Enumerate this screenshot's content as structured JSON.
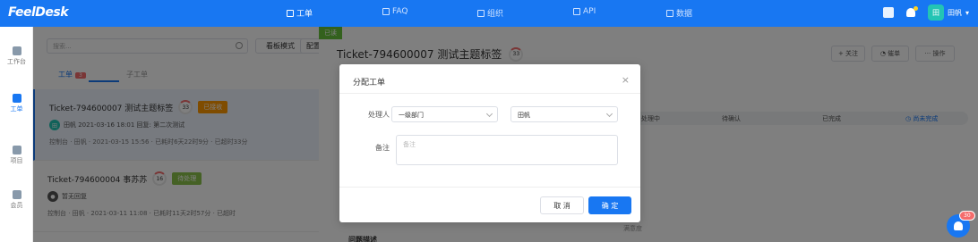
{
  "app": {
    "logo": "FeelDesk"
  },
  "topnav": {
    "items": [
      {
        "label": "工单",
        "icon": "ticket-icon",
        "active": true
      },
      {
        "label": "FAQ",
        "icon": "faq-icon",
        "active": false
      },
      {
        "label": "组织",
        "icon": "org-icon",
        "active": false
      },
      {
        "label": "API",
        "icon": "api-icon",
        "active": false
      },
      {
        "label": "数据",
        "icon": "chart-icon",
        "active": false
      }
    ],
    "user": {
      "avatar": "田",
      "name": "田帆"
    }
  },
  "sidebar": {
    "items": [
      {
        "label": "工作台",
        "icon": "dashboard-icon",
        "active": false
      },
      {
        "label": "工单",
        "icon": "ticket-icon",
        "active": true
      },
      {
        "label": "项目",
        "icon": "folder-icon",
        "active": false
      },
      {
        "label": "会员",
        "icon": "member-icon",
        "active": false
      }
    ]
  },
  "list": {
    "search_placeholder": "搜索...",
    "kanban_button": "看板模式",
    "config_button": "配置",
    "tabs": [
      {
        "label": "工单",
        "count": "3",
        "active": true
      },
      {
        "label": "子工单",
        "active": false
      }
    ],
    "tickets": [
      {
        "id_title": "Ticket-794600007  测试主题标签",
        "progress": "33",
        "status": "已接收",
        "status_color": "#ff9800",
        "avatar": "田",
        "avatar_color": "#23c4b4",
        "reply": "田帆  2021-03-16 18:01 回复: 第二次测试",
        "info": "控制台  ·  田帆  ·  2021-03-15 15:56  ·  已耗时6天22时9分  ·  已超时33分"
      },
      {
        "id_title": "Ticket-794600004  事苏苏",
        "progress": "16",
        "status": "待处理",
        "status_color": "#8bc34a",
        "avatar": "●",
        "avatar_color": "#555555",
        "reply": "暂无回复",
        "info": "控制台  ·  田帆  ·  2021-03-11 11:08  ·  已耗时11天2时57分  ·  已超时"
      }
    ]
  },
  "detail": {
    "read_tag": "已读",
    "title": "Ticket-794600007  测试主题标签",
    "progress": "33",
    "follow_button": "+ 关注",
    "urge_button": "催单",
    "more_button": "··· 操作",
    "steps": [
      "处理中",
      "待确认",
      "已完成"
    ],
    "end_step": "尚未完成",
    "fade_text": "满意度",
    "section_title": "问题描述"
  },
  "dialog": {
    "title": "分配工单",
    "handler_label": "处理人",
    "department_value": "一级部门",
    "user_value": "田帆",
    "remark_label": "备注",
    "remark_placeholder": "备注",
    "cancel": "取 消",
    "confirm": "确 定"
  },
  "notifications": {
    "count": "30"
  }
}
